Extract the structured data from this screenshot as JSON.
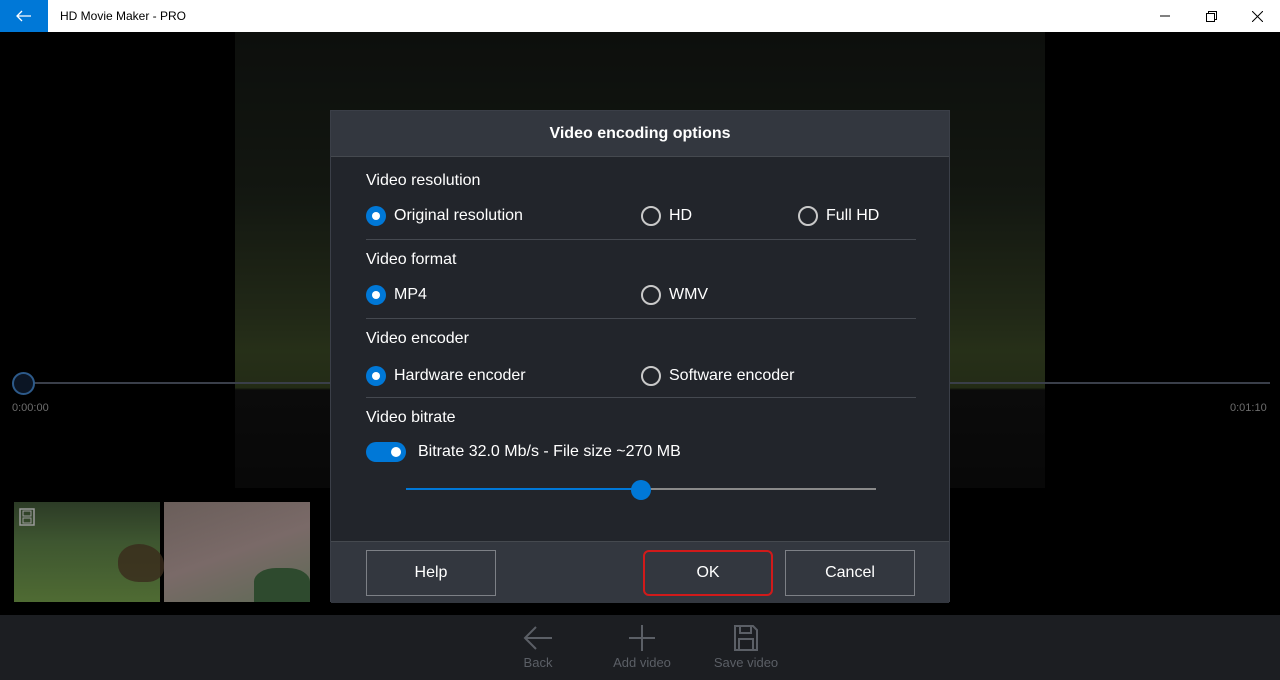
{
  "app": {
    "title": "HD Movie Maker - PRO"
  },
  "player": {
    "time_start": "0:00:00",
    "time_end": "0:01:10",
    "position": 0.0
  },
  "toolbar": {
    "items": [
      {
        "label": "Back",
        "icon": "arrow-left-icon"
      },
      {
        "label": "Add video",
        "icon": "plus-icon"
      },
      {
        "label": "Save video",
        "icon": "floppy-disk-icon"
      }
    ]
  },
  "dialog": {
    "title": "Video encoding options",
    "resolution": {
      "title": "Video resolution",
      "options": [
        "Original resolution",
        "HD",
        "Full HD"
      ],
      "selected": "Original resolution"
    },
    "format": {
      "title": "Video format",
      "options": [
        "MP4",
        "WMV"
      ],
      "selected": "MP4"
    },
    "encoder": {
      "title": "Video encoder",
      "options": [
        "Hardware encoder",
        "Software encoder"
      ],
      "selected": "Hardware encoder"
    },
    "bitrate": {
      "title": "Video bitrate",
      "enabled": true,
      "label": "Bitrate 32.0 Mb/s - File size ~270 MB",
      "slider_fraction": 0.5
    },
    "buttons": {
      "help": "Help",
      "ok": "OK",
      "cancel": "Cancel"
    }
  },
  "colors": {
    "accent": "#0078d7",
    "highlight": "#d11a1a"
  }
}
